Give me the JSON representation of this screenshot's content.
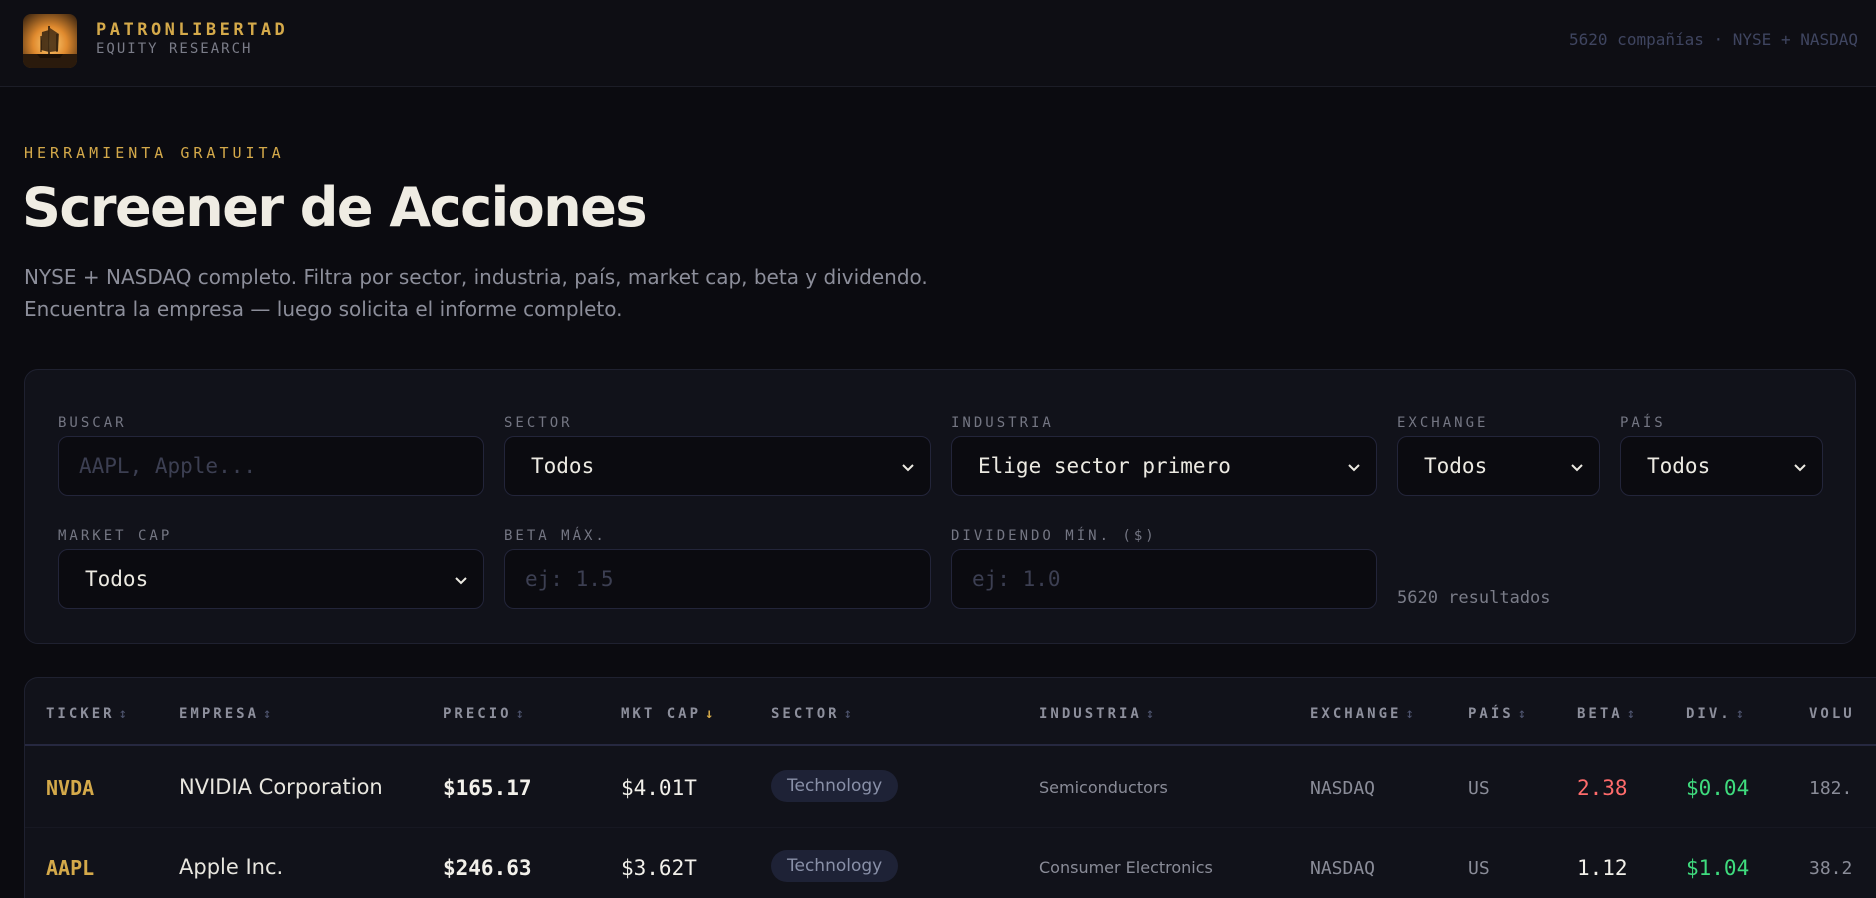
{
  "header": {
    "brand_name": "PATRONLIBERTAD",
    "brand_sub": "EQUITY RESEARCH",
    "count_info": "5620 compañías · NYSE + NASDAQ"
  },
  "hero": {
    "eyebrow": "HERRAMIENTA GRATUITA",
    "title": "Screener de Acciones",
    "desc_line1": "NYSE + NASDAQ completo. Filtra por sector, industria, país, market cap, beta y dividendo.",
    "desc_line2": "Encuentra la empresa — luego solicita el informe completo."
  },
  "filters": {
    "search": {
      "label": "BUSCAR",
      "placeholder": "AAPL, Apple..."
    },
    "sector": {
      "label": "SECTOR",
      "value": "Todos"
    },
    "industry": {
      "label": "INDUSTRIA",
      "value": "Elige sector primero"
    },
    "exchange": {
      "label": "EXCHANGE",
      "value": "Todos"
    },
    "country": {
      "label": "PAÍS",
      "value": "Todos"
    },
    "market_cap": {
      "label": "MARKET CAP",
      "value": "Todos"
    },
    "beta_max": {
      "label": "BETA MÁX.",
      "placeholder": "ej: 1.5"
    },
    "div_min": {
      "label": "DIVIDENDO MÍN. ($)",
      "placeholder": "ej: 1.0"
    },
    "results": "5620 resultados"
  },
  "table": {
    "columns": {
      "ticker": "TICKER",
      "company": "EMPRESA",
      "price": "PRECIO",
      "mktcap": "MKT CAP",
      "sector": "SECTOR",
      "industry": "INDUSTRIA",
      "exchange": "EXCHANGE",
      "country": "PAÍS",
      "beta": "BETA",
      "div": "DIV.",
      "volume": "VOLU"
    },
    "sort_icon": "↕",
    "sort_active_icon": "↓",
    "rows": [
      {
        "ticker": "NVDA",
        "company": "NVIDIA Corporation",
        "price": "$165.17",
        "mktcap": "$4.01T",
        "sector": "Technology",
        "industry": "Semiconductors",
        "exchange": "NASDAQ",
        "country": "US",
        "beta": "2.38",
        "beta_color": "#ff6b6b",
        "div": "$0.04",
        "volume": "182."
      },
      {
        "ticker": "AAPL",
        "company": "Apple Inc.",
        "price": "$246.63",
        "mktcap": "$3.62T",
        "sector": "Technology",
        "industry": "Consumer Electronics",
        "exchange": "NASDAQ",
        "country": "US",
        "beta": "1.12",
        "beta_color": "#f2f0ea",
        "div": "$1.04",
        "volume": "38.2"
      }
    ]
  },
  "colors": {
    "accent": "#d4a94a",
    "positive": "#3fdc7e",
    "negative": "#ff6b6b"
  }
}
